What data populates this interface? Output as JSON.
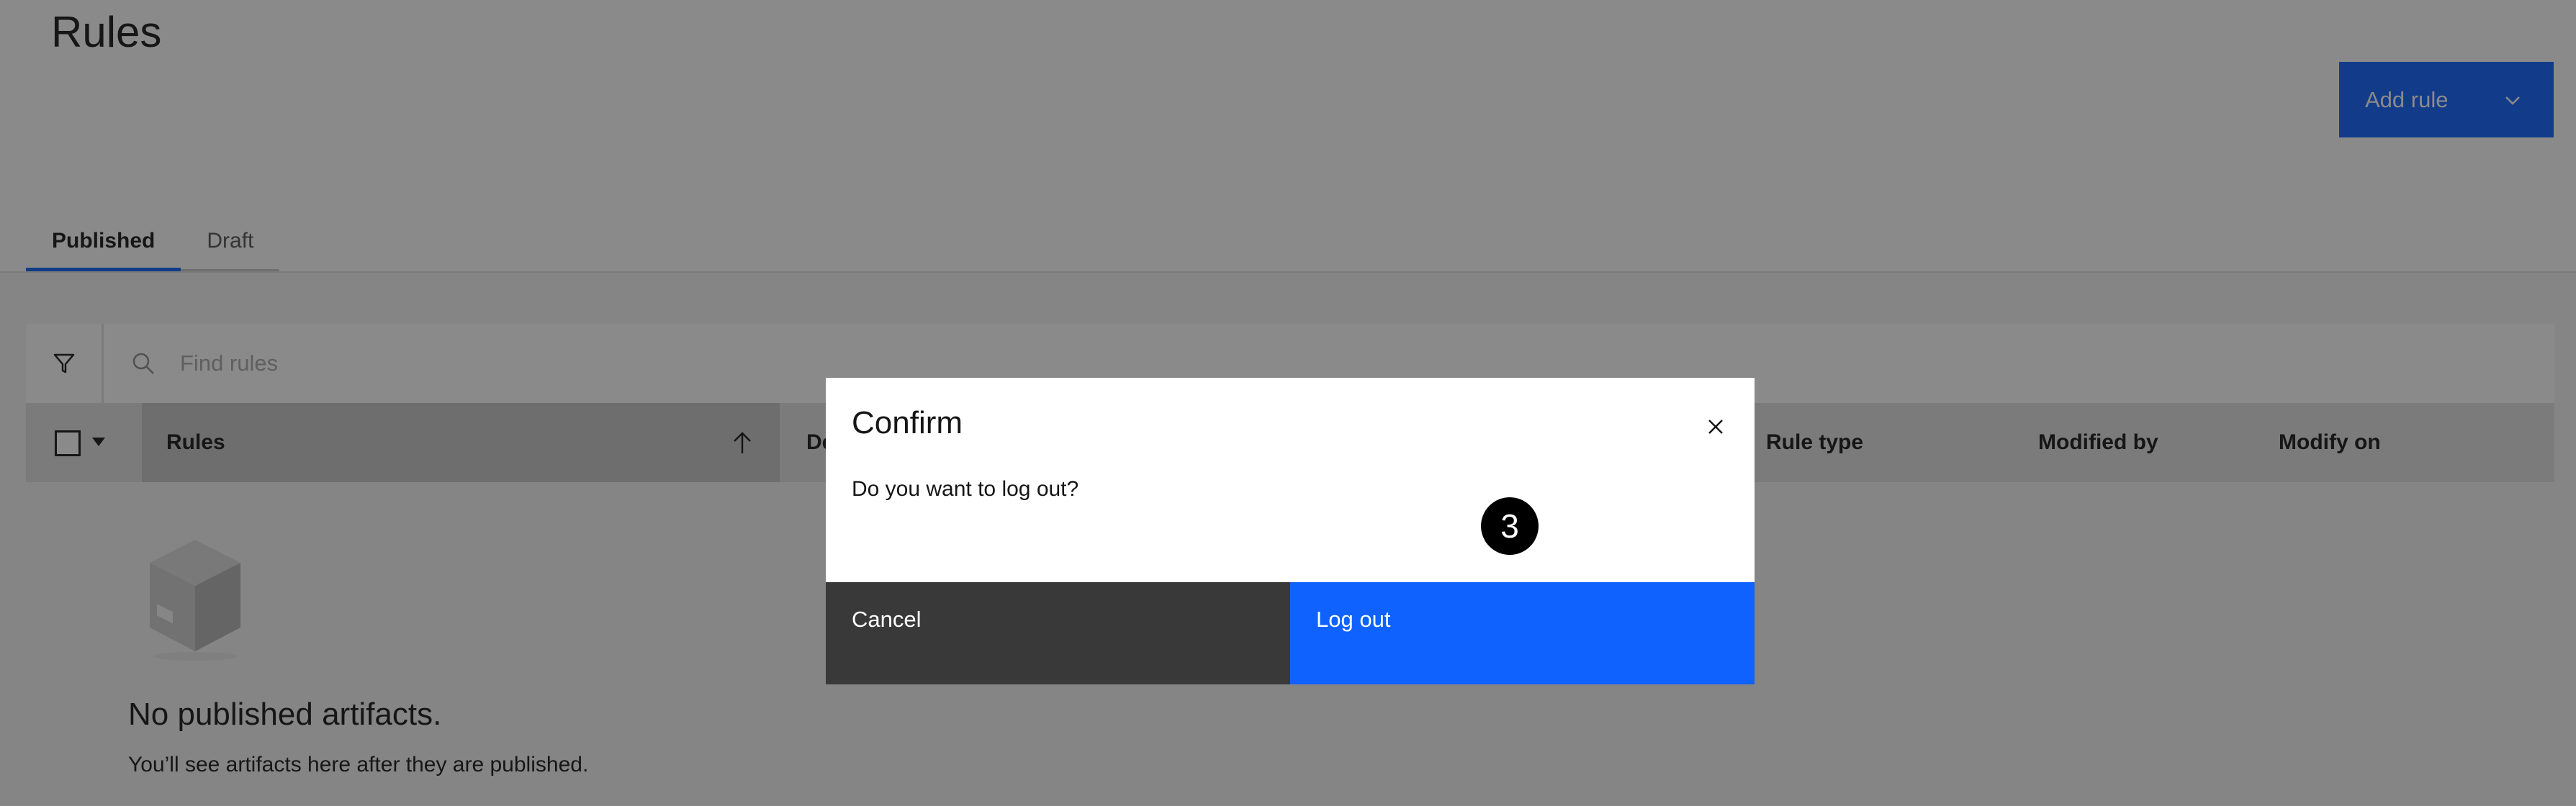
{
  "page": {
    "title": "Rules",
    "add_rule_label": "Add rule"
  },
  "tabs": [
    {
      "label": "Published",
      "active": true
    },
    {
      "label": "Draft",
      "active": false
    }
  ],
  "search": {
    "placeholder": "Find rules"
  },
  "table": {
    "columns": [
      "Rules",
      "De",
      "Rule type",
      "Modified by",
      "Modify on"
    ],
    "sort_column": "Rules",
    "sort_direction": "ascending"
  },
  "empty_state": {
    "title": "No published artifacts.",
    "subtitle": "You’ll see artifacts here after they are published."
  },
  "modal": {
    "title": "Confirm",
    "body": "Do you want to log out?",
    "cancel_label": "Cancel",
    "confirm_label": "Log out",
    "step_badge": "3"
  },
  "colors": {
    "primary": "#0f62fe",
    "secondary_button": "#393939",
    "overlay": "rgba(22,22,22,0.5)"
  },
  "icons": {
    "filter": "filter-icon",
    "search": "search-icon",
    "close": "close-icon",
    "sort": "arrow-up-icon",
    "chevron": "chevron-down-icon",
    "empty": "box-icon"
  }
}
